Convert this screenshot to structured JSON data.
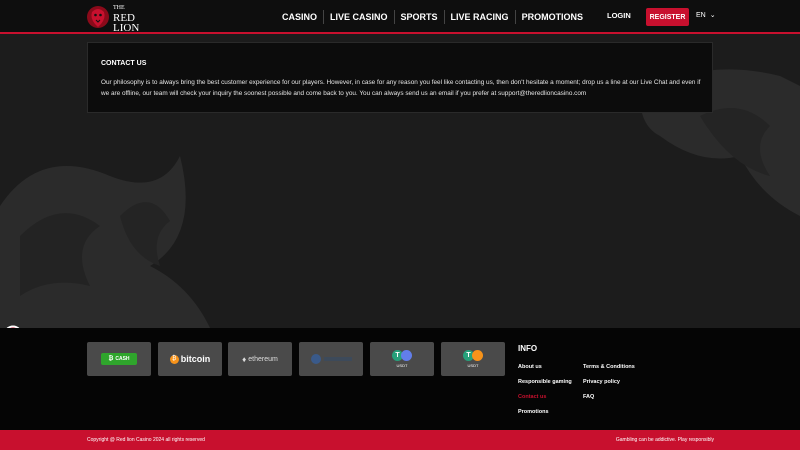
{
  "header": {
    "logo": {
      "the": "THE",
      "red": "RED",
      "lion": "LION"
    },
    "nav": [
      "CASINO",
      "LIVE CASINO",
      "SPORTS",
      "LIVE RACING",
      "PROMOTIONS"
    ],
    "login_label": "LOGIN",
    "register_label": "REGISTER",
    "language": "EN"
  },
  "contact": {
    "title": "CONTACT US",
    "body": "Our philosophy is to always bring the best customer experience for our players. However, in case for any reason you feel like contacting us, then don't hesitate a moment; drop us a line at our Live Chat and even if we are offline, our team will check your inquiry the soonest possible and come back to you. You can always send us an email if you prefer at support@theredlioncasino.com"
  },
  "payments": [
    {
      "name": "bitcoin-cash",
      "label": "CASH"
    },
    {
      "name": "bitcoin",
      "label": "bitcoin"
    },
    {
      "name": "ethereum",
      "label": "ethereum"
    },
    {
      "name": "crypto-4",
      "label": ""
    },
    {
      "name": "usdt-erc20",
      "label": "USDT"
    },
    {
      "name": "usdt-trc20",
      "label": "USDT"
    }
  ],
  "footer": {
    "info_title": "INFO",
    "links": {
      "about": "About us",
      "responsible": "Responsible gaming",
      "contact": "Contact us",
      "promotions": "Promotions",
      "terms": "Terms & Conditions",
      "privacy": "Privacy policy",
      "faq": "FAQ"
    },
    "copyright": "Copyright @ Red lion Casino 2024 all rights reserved",
    "responsible_note": "Gambling can be addictive. Play responsibly"
  },
  "colors": {
    "brand_red": "#c8102e",
    "background": "#1c1c1c",
    "footer": "#050505"
  }
}
